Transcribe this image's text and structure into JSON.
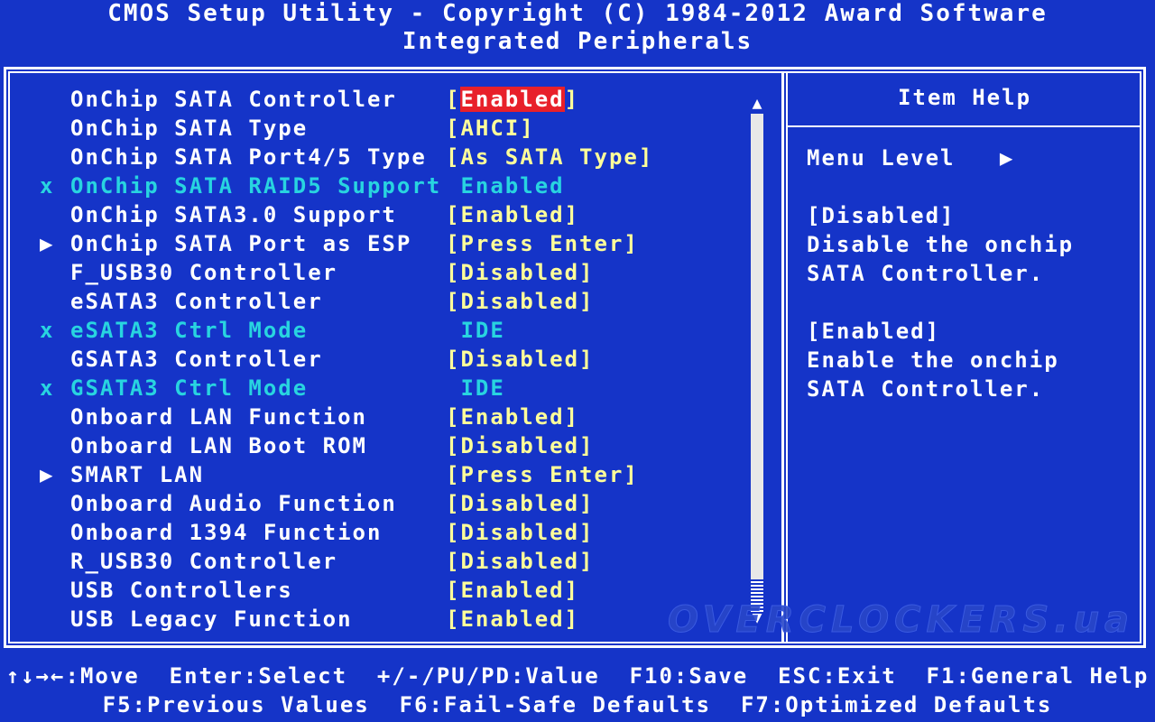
{
  "header": {
    "title": "CMOS Setup Utility - Copyright (C) 1984-2012 Award Software",
    "subtitle": "Integrated Peripherals"
  },
  "settings": [
    {
      "marker": "",
      "label": "OnChip SATA Controller",
      "value_prefix": "[",
      "value_highlight": "Enabled",
      "value_suffix": "]",
      "state": "normal"
    },
    {
      "marker": "",
      "label": "OnChip SATA Type",
      "value": "[AHCI]",
      "state": "normal"
    },
    {
      "marker": "",
      "label": "OnChip SATA Port4/5 Type",
      "value": "[As SATA Type]",
      "state": "normal"
    },
    {
      "marker": "x",
      "label": "OnChip SATA RAID5 Support",
      "value": " Enabled",
      "state": "disabled"
    },
    {
      "marker": "",
      "label": "OnChip SATA3.0 Support",
      "value": "[Enabled]",
      "state": "normal"
    },
    {
      "marker": "▶",
      "label": "OnChip SATA Port as ESP",
      "value": "[Press Enter]",
      "state": "normal"
    },
    {
      "marker": "",
      "label": "F_USB30 Controller",
      "value": "[Disabled]",
      "state": "normal"
    },
    {
      "marker": "",
      "label": "eSATA3 Controller",
      "value": "[Disabled]",
      "state": "normal"
    },
    {
      "marker": "x",
      "label": "eSATA3 Ctrl Mode",
      "value": " IDE",
      "state": "disabled"
    },
    {
      "marker": "",
      "label": "GSATA3 Controller",
      "value": "[Disabled]",
      "state": "normal"
    },
    {
      "marker": "x",
      "label": "GSATA3 Ctrl Mode",
      "value": " IDE",
      "state": "disabled"
    },
    {
      "marker": "",
      "label": "Onboard LAN Function",
      "value": "[Enabled]",
      "state": "normal"
    },
    {
      "marker": "",
      "label": "Onboard LAN Boot ROM",
      "value": "[Disabled]",
      "state": "normal"
    },
    {
      "marker": "▶",
      "label": "SMART LAN",
      "value": "[Press Enter]",
      "state": "normal"
    },
    {
      "marker": "",
      "label": "Onboard Audio Function",
      "value": "[Disabled]",
      "state": "normal"
    },
    {
      "marker": "",
      "label": "Onboard 1394 Function",
      "value": "[Disabled]",
      "state": "normal"
    },
    {
      "marker": "",
      "label": "R_USB30 Controller",
      "value": "[Disabled]",
      "state": "normal"
    },
    {
      "marker": "",
      "label": "USB Controllers",
      "value": "[Enabled]",
      "state": "normal"
    },
    {
      "marker": "",
      "label": "USB Legacy Function",
      "value": "[Enabled]",
      "state": "normal"
    }
  ],
  "scrollbar": {
    "up_arrow": "▲",
    "down_arrow": "▼"
  },
  "help": {
    "title": "Item Help",
    "menu_level_label": "Menu Level",
    "menu_level_arrow": "▶",
    "lines": [
      "[Disabled]",
      "Disable the onchip",
      "SATA Controller.",
      "",
      "[Enabled]",
      "Enable the onchip",
      "SATA Controller."
    ]
  },
  "footer": {
    "line1": "↑↓→←:Move  Enter:Select  +/-/PU/PD:Value  F10:Save  ESC:Exit  F1:General Help",
    "line2": "F5:Previous Values  F6:Fail-Safe Defaults  F7:Optimized Defaults"
  },
  "watermark": "OVERCLOCKERS.ua",
  "colors": {
    "background": "#1534c8",
    "value_text": "#ffff9a",
    "disabled_text": "#28d4e0",
    "highlight": "#e8202a"
  }
}
